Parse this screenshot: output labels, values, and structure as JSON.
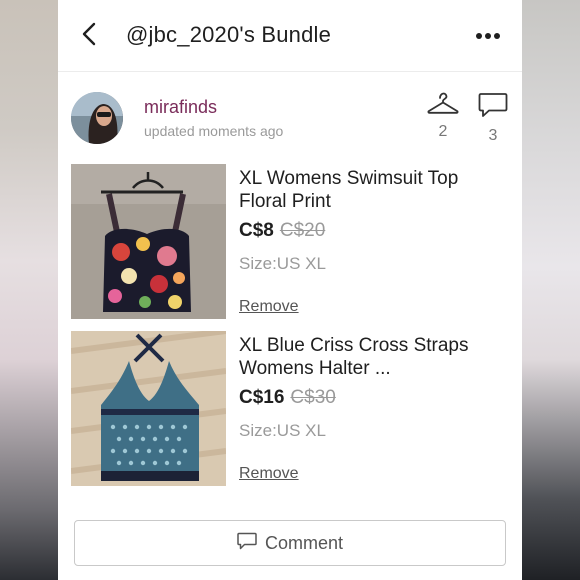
{
  "header": {
    "title": "@jbc_2020's Bundle",
    "back_icon": "chevron-left-icon",
    "more_icon": "more-horizontal-icon"
  },
  "seller": {
    "name": "mirafinds",
    "updated": "updated moments ago",
    "likes_count": "2",
    "comments_count": "3"
  },
  "items": [
    {
      "title": "XL Womens Swimsuit Top Floral Print",
      "price": "C$8",
      "original_price": "C$20",
      "size": "Size:US XL",
      "remove_label": "Remove"
    },
    {
      "title": "XL Blue Criss Cross Straps Womens Halter ...",
      "price": "C$16",
      "original_price": "C$30",
      "size": "Size:US XL",
      "remove_label": "Remove"
    }
  ],
  "footer": {
    "comment_label": "Comment"
  },
  "colors": {
    "seller_name": "#7a2c5a",
    "muted_text": "#9a9a9a",
    "primary_text": "#1f1f1f"
  }
}
